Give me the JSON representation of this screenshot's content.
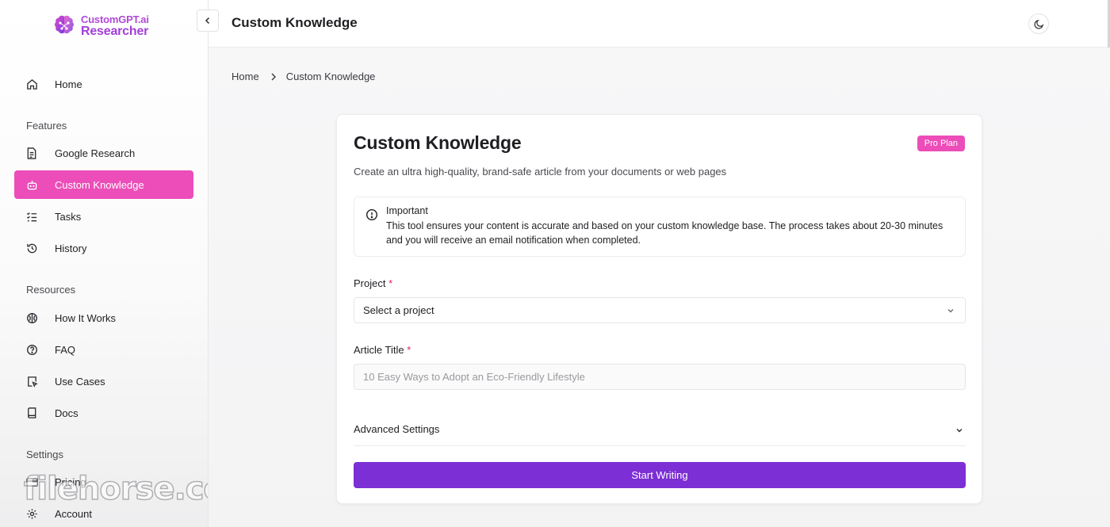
{
  "app": {
    "logo_line1": "CustomGPT.ai",
    "logo_line2": "Researcher"
  },
  "sidebar": {
    "home": {
      "label": "Home",
      "icon": "home-icon"
    },
    "sections": [
      {
        "label": "Features",
        "items": [
          {
            "label": "Google Research",
            "icon": "document-icon"
          },
          {
            "label": "Custom Knowledge",
            "icon": "robot-icon",
            "active": true
          },
          {
            "label": "Tasks",
            "icon": "checklist-icon"
          },
          {
            "label": "History",
            "icon": "history-icon"
          }
        ]
      },
      {
        "label": "Resources",
        "items": [
          {
            "label": "How It Works",
            "icon": "brain-icon"
          },
          {
            "label": "FAQ",
            "icon": "help-circle-icon"
          },
          {
            "label": "Use Cases",
            "icon": "use-cases-icon"
          },
          {
            "label": "Docs",
            "icon": "book-icon"
          }
        ]
      },
      {
        "label": "Settings",
        "items": [
          {
            "label": "Pricing",
            "icon": "credit-card-icon"
          },
          {
            "label": "Account",
            "icon": "gear-icon"
          }
        ]
      }
    ],
    "watermark": "filehorse.com"
  },
  "header": {
    "title": "Custom Knowledge"
  },
  "breadcrumb": {
    "home": "Home",
    "current": "Custom Knowledge"
  },
  "card": {
    "title": "Custom Knowledge",
    "badge": "Pro Plan",
    "subtitle": "Create an ultra high-quality, brand-safe article from your documents or web pages",
    "notice": {
      "title": "Important",
      "body": "This tool ensures your content is accurate and based on your custom knowledge base. The process takes about 20-30 minutes and you will receive an email notification when completed."
    },
    "project": {
      "label": "Project",
      "required_mark": "*",
      "value": "Select a project"
    },
    "article_title": {
      "label": "Article Title",
      "required_mark": "*",
      "placeholder": "10 Easy Ways to Adopt an Eco-Friendly Lifestyle"
    },
    "advanced_settings": "Advanced Settings",
    "submit_label": "Start Writing"
  },
  "colors": {
    "accent_pink": "#ec4db8",
    "primary_purple": "#7b2fd4",
    "logo_purple": "#a23fd9"
  }
}
